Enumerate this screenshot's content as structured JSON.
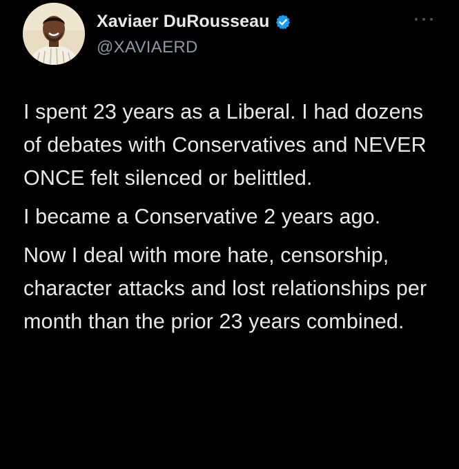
{
  "tweet": {
    "author": {
      "display_name": "Xaviaer DuRousseau",
      "handle": "@XAVIAERD",
      "verified": true
    },
    "icons": {
      "verified": "verified-badge-icon",
      "more": "more-options-icon"
    },
    "colors": {
      "background": "#000000",
      "text": "#e7e9ea",
      "muted": "#8b98a5",
      "verified": "#1d9bf0"
    },
    "paragraphs": [
      "I spent 23 years as a Liberal. I had dozens of debates with Conservatives and NEVER ONCE felt silenced or belittled.",
      "I became a Conservative 2 years ago.",
      "Now I deal with more hate, censorship, character attacks and lost relationships per month than the prior 23 years combined."
    ]
  }
}
